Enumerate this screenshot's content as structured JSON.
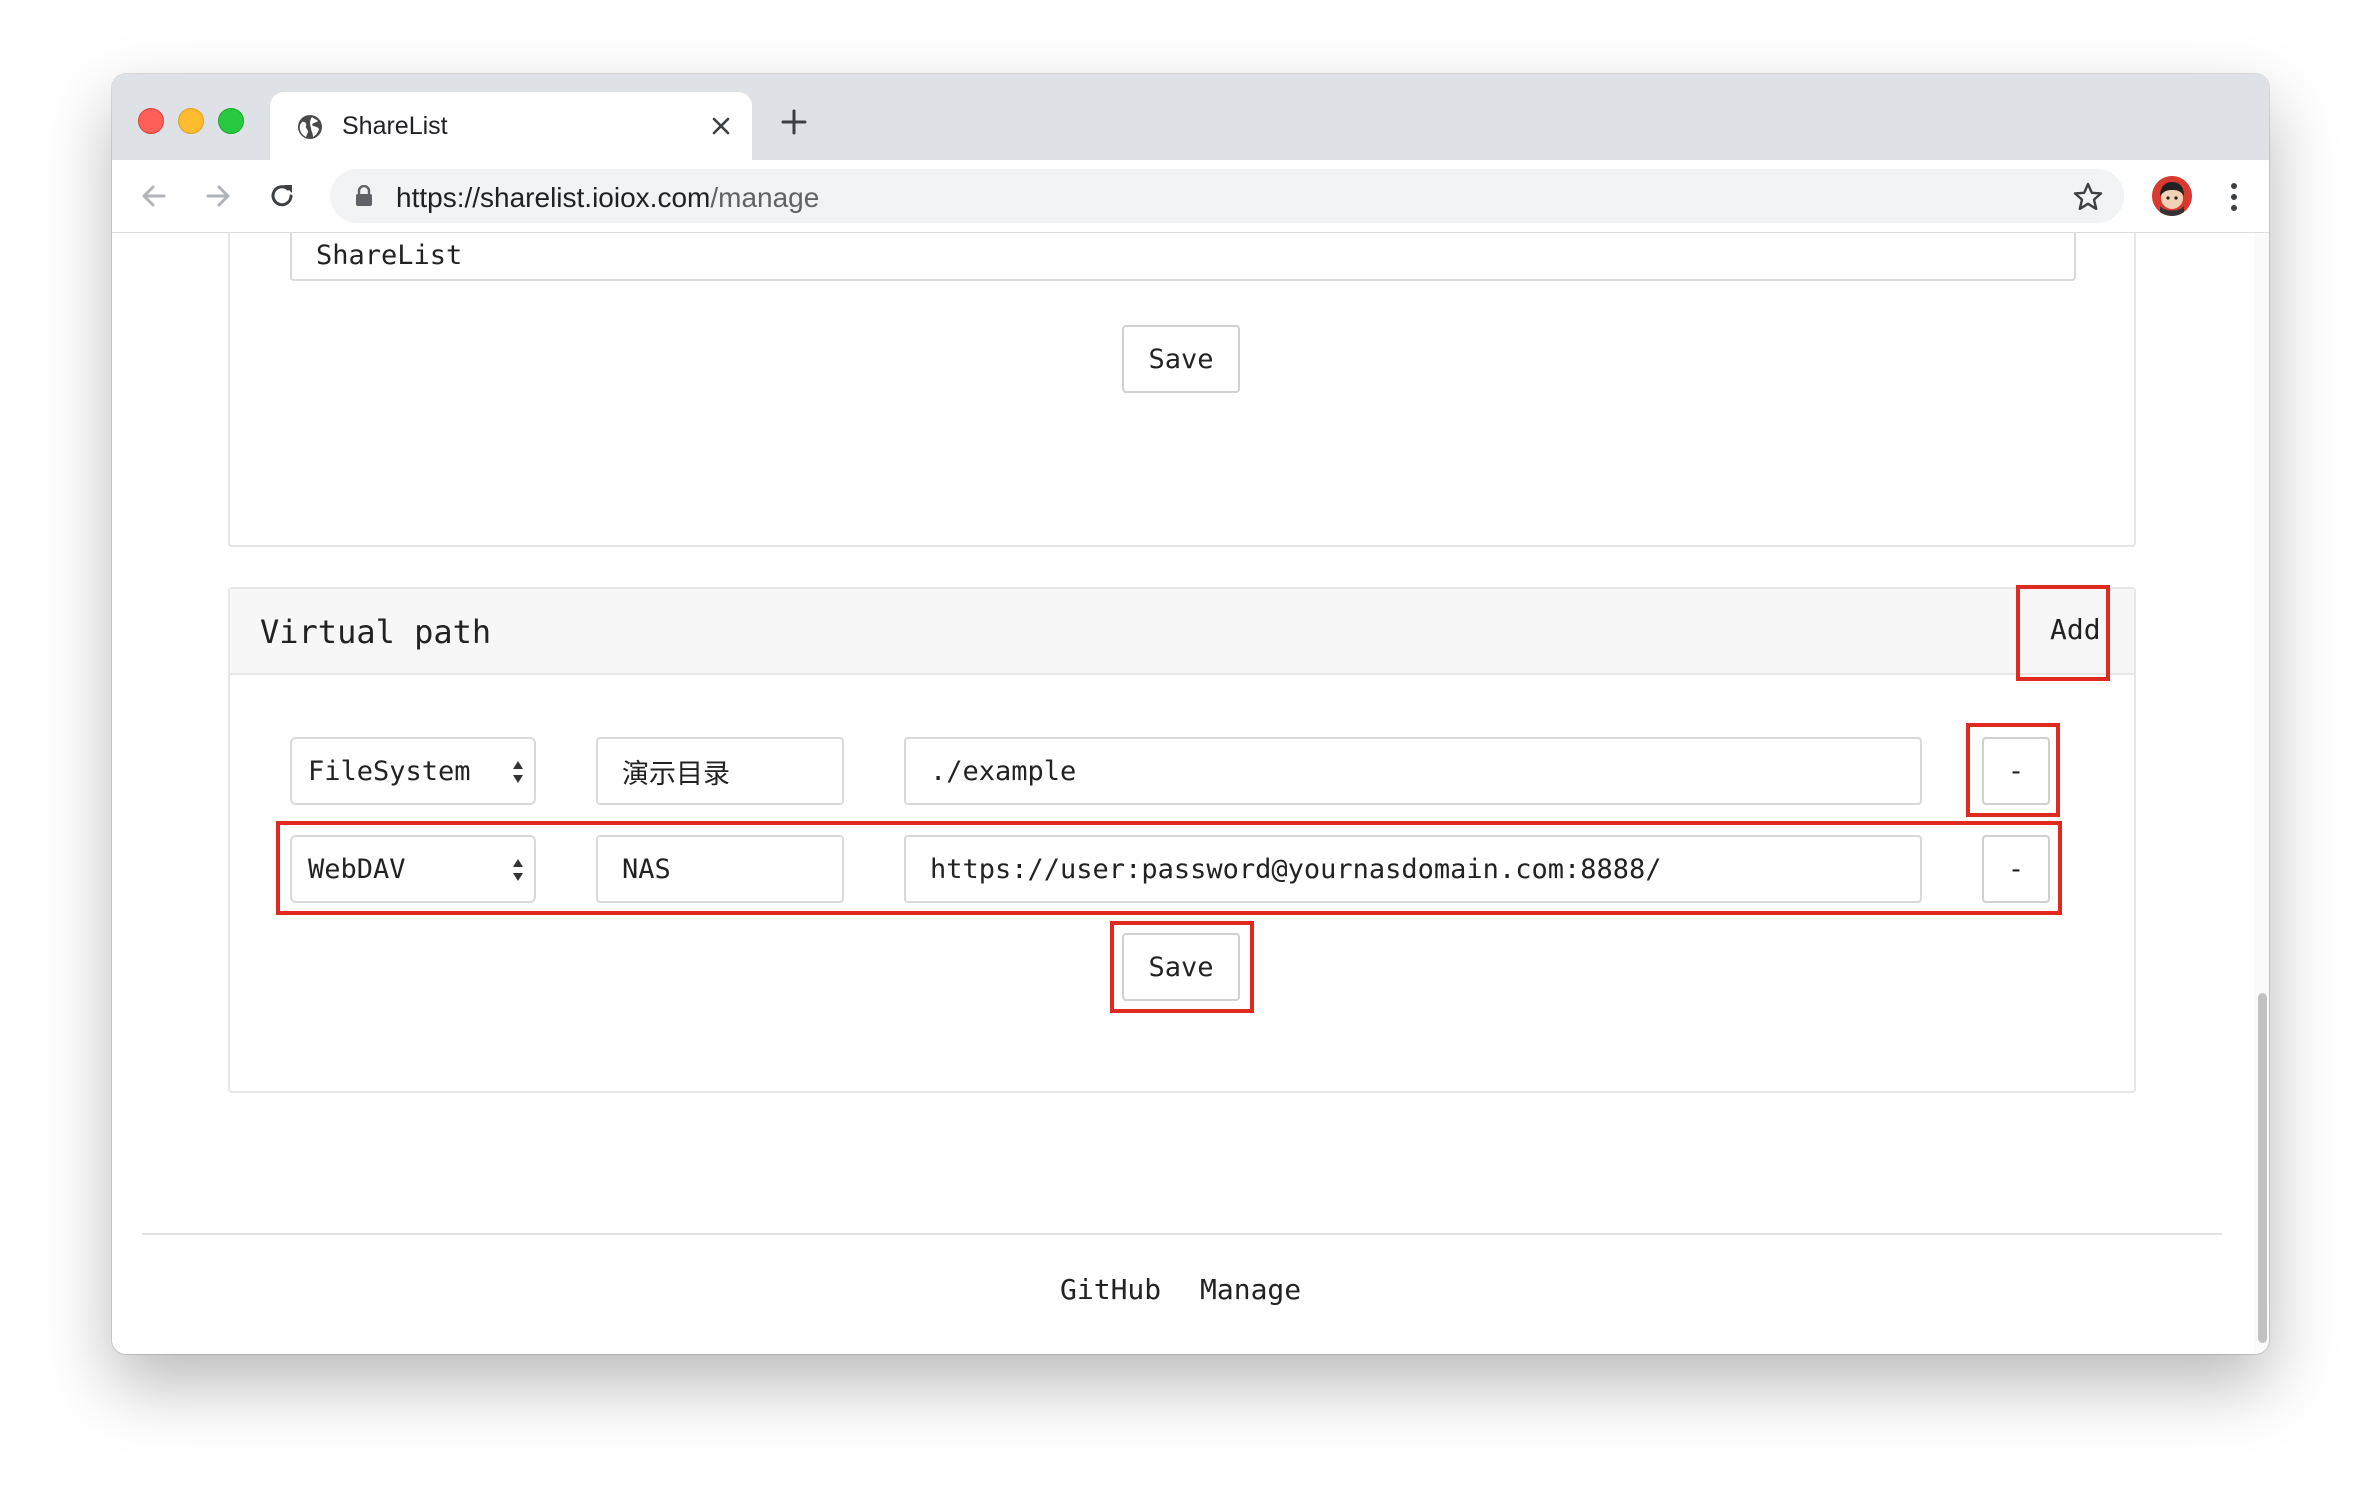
{
  "browser": {
    "tab_title": "ShareList",
    "url_host": "https://sharelist.ioiox.com",
    "url_path": "/manage"
  },
  "page": {
    "site_title_value": "ShareList",
    "site_save_label": "Save",
    "virtual_path": {
      "title": "Virtual path",
      "add_label": "Add",
      "rows": [
        {
          "type": "FileSystem",
          "name": "演示目录",
          "path": "./example",
          "remove_label": "-"
        },
        {
          "type": "WebDAV",
          "name": "NAS",
          "path": "https://user:password@yournasdomain.com:8888/",
          "remove_label": "-"
        }
      ],
      "save_label": "Save"
    },
    "footer": {
      "links": [
        "GitHub",
        "Manage"
      ]
    }
  },
  "colors": {
    "highlight": "#e02a20",
    "tabstrip": "#dee1e6"
  }
}
